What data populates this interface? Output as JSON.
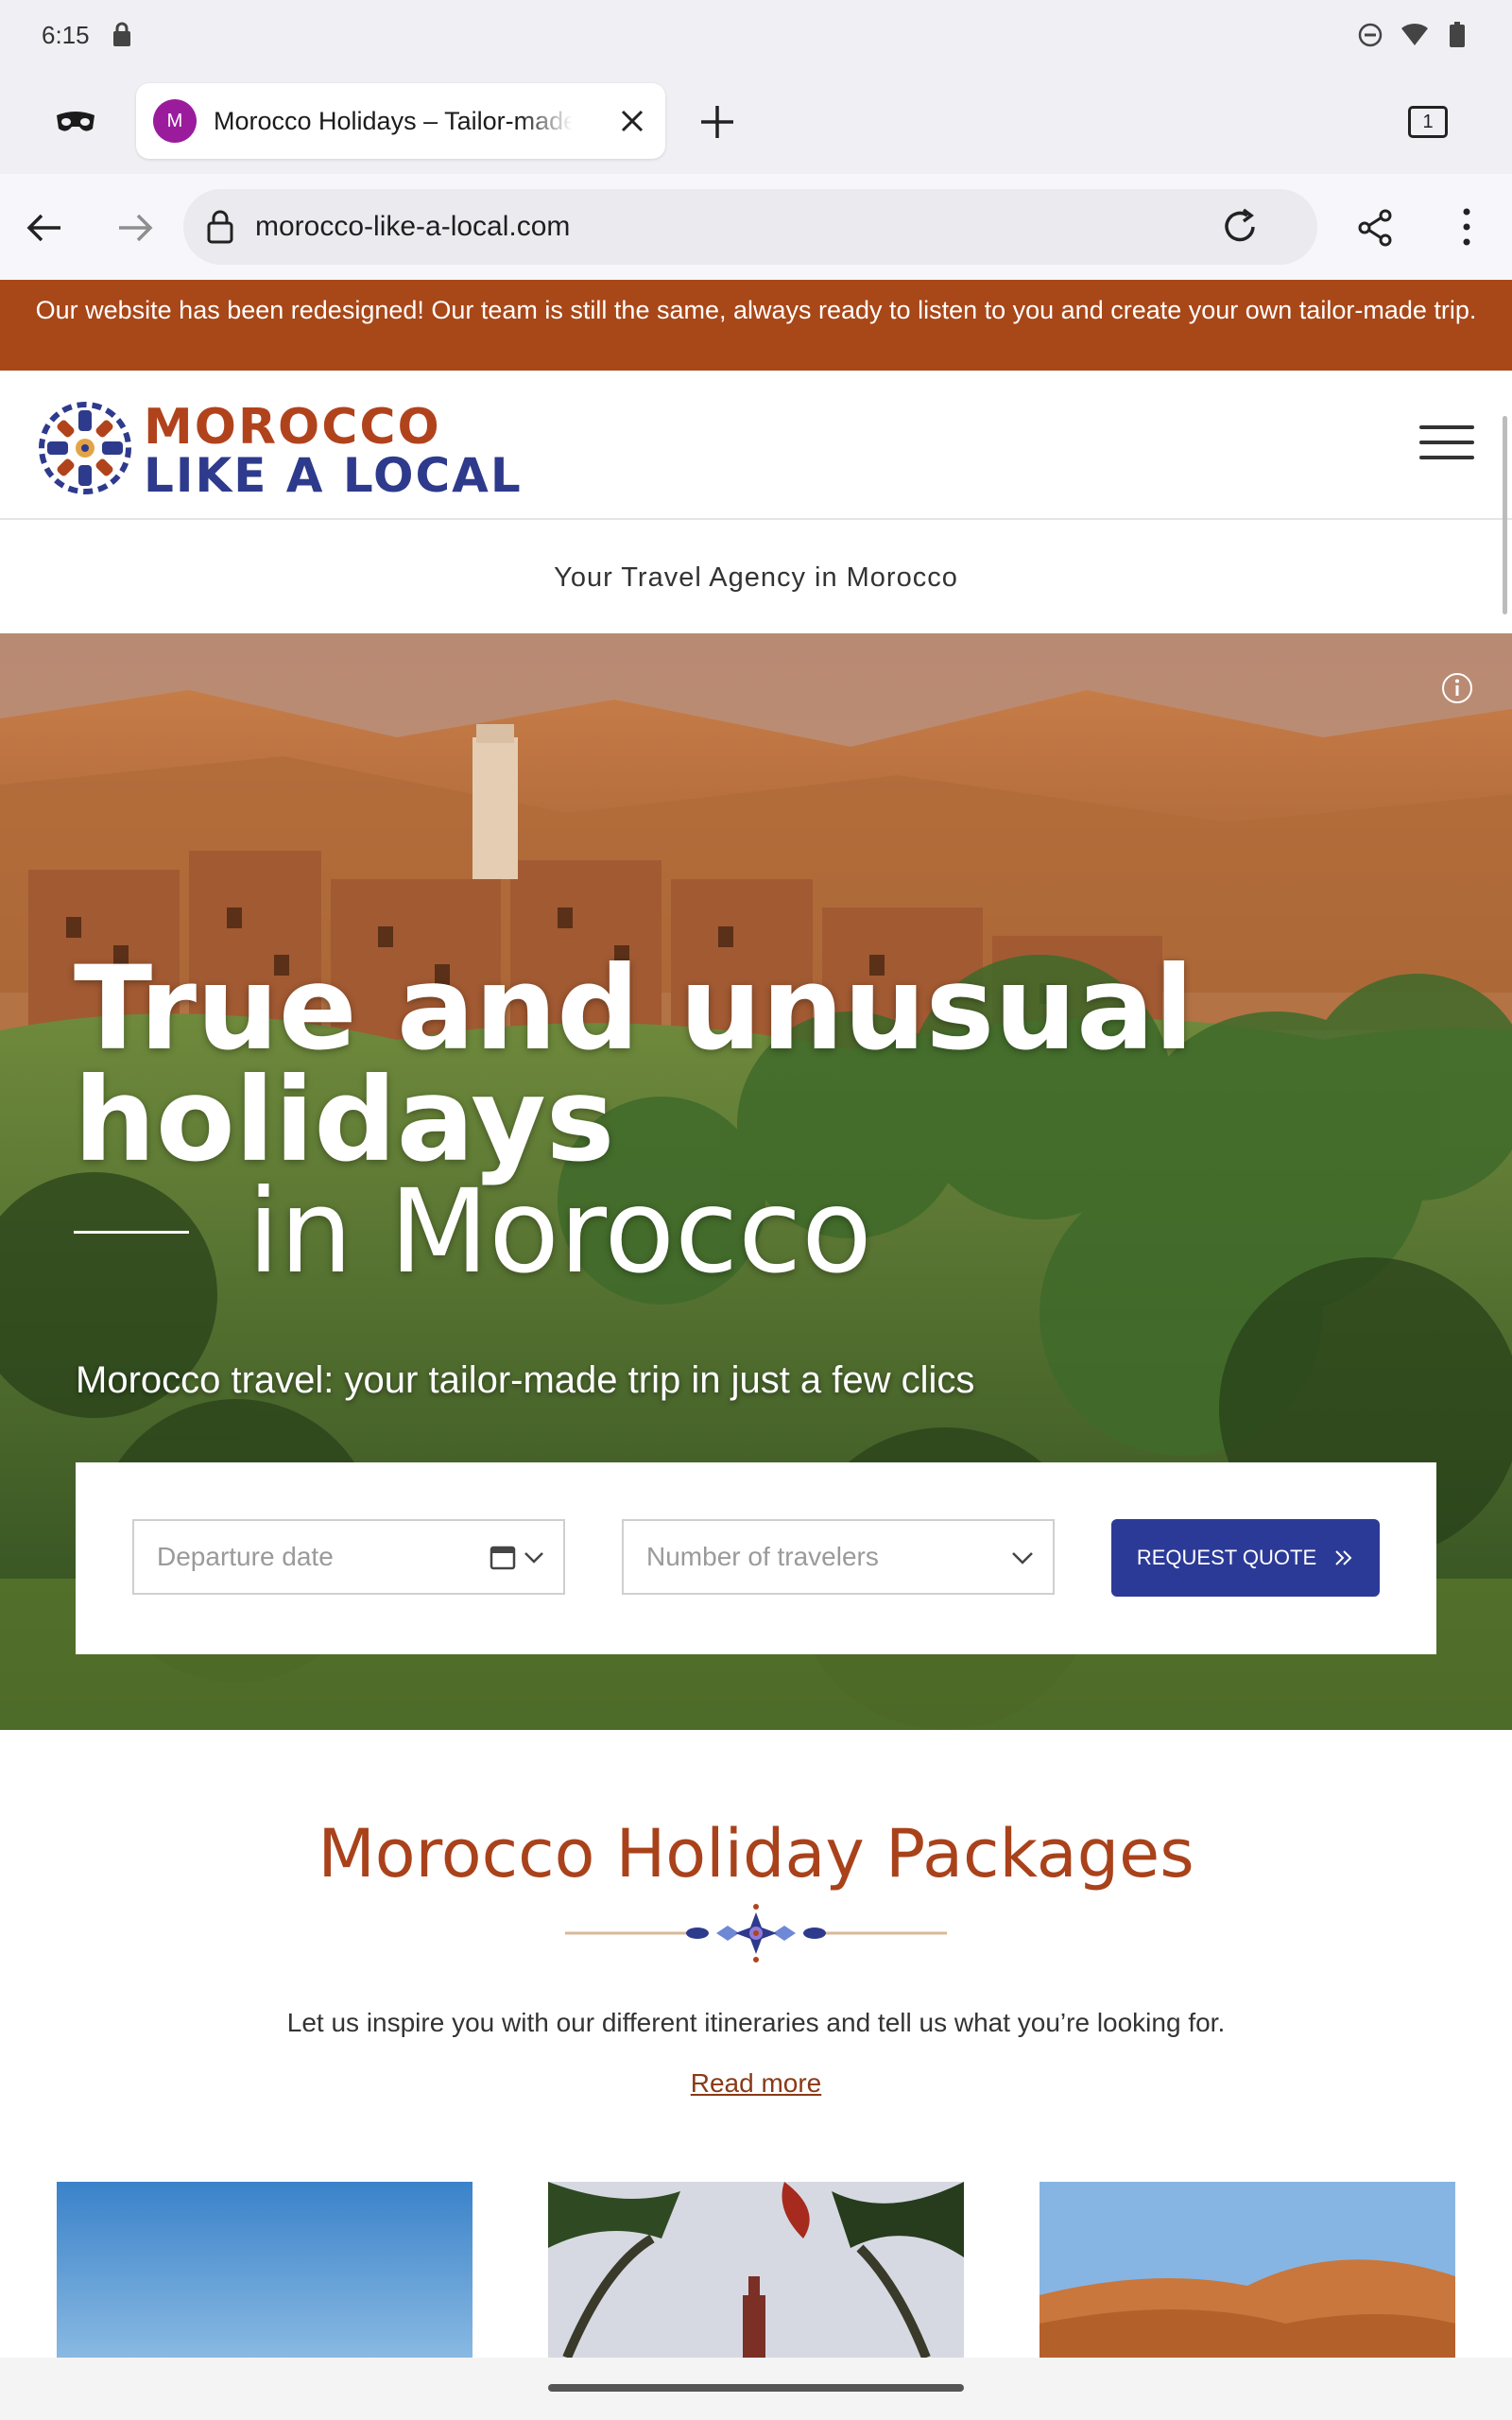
{
  "status_bar": {
    "time": "6:15"
  },
  "browser": {
    "tab": {
      "favicon_letter": "M",
      "title": "Morocco Holidays – Tailor-made"
    },
    "tab_count": "1",
    "url": "morocco-like-a-local.com"
  },
  "announcement": "Our website has been redesigned! Our team is still the same, always ready to listen to you and create your own tailor-made trip.",
  "site": {
    "logo_line1": "MOROCCO",
    "logo_line2": "LIKE A LOCAL",
    "tagline": "Your Travel Agency in Morocco"
  },
  "hero": {
    "line1": "True and unusual",
    "line2": "holidays",
    "line3": "in Morocco",
    "subtitle": "Morocco travel: your tailor-made trip in just a few clics",
    "departure_placeholder": "Departure date",
    "travelers_placeholder": "Number of travelers",
    "quote_button": "REQUEST QUOTE"
  },
  "packages": {
    "title": "Morocco Holiday Packages",
    "description": "Let us inspire you with our different itineraries and tell us what you’re looking for.",
    "read_more": "Read more"
  },
  "colors": {
    "brand_rust": "#a84718",
    "brand_blue": "#2c3a97",
    "favicon_purple": "#9b1b9d"
  }
}
